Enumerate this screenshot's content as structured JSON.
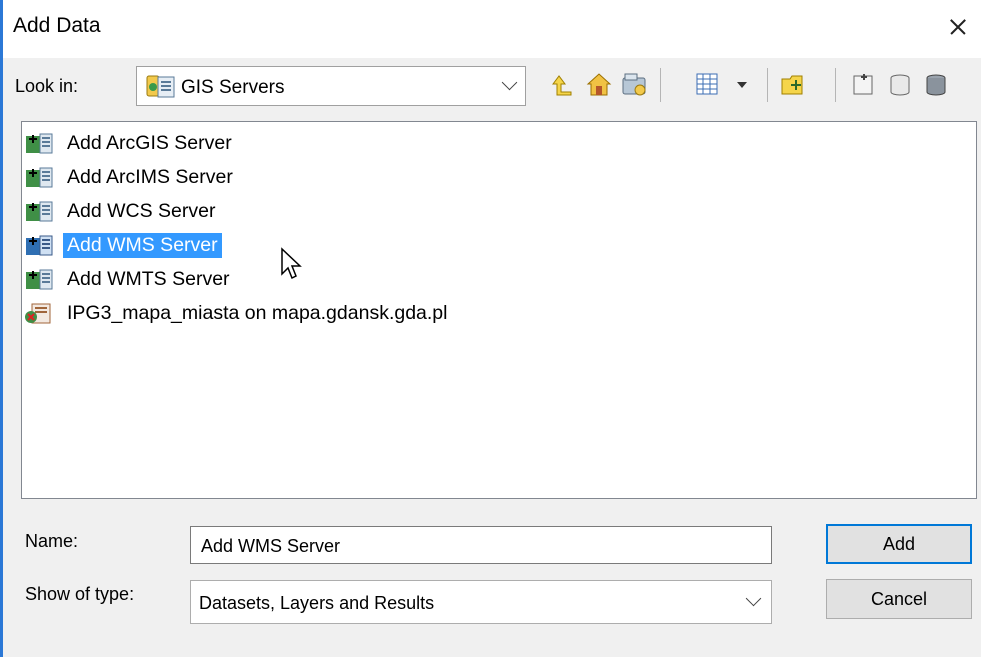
{
  "window": {
    "title": "Add Data"
  },
  "toolbar": {
    "look_in_label": "Look in:",
    "location": "GIS Servers",
    "icons": [
      "up-one-level-icon",
      "home-icon",
      "connect-folder-icon",
      "view-menu-icon",
      "new-folder-icon",
      "new-file-geodatabase-icon",
      "new-personal-geodatabase-icon",
      "new-server-connection-icon"
    ]
  },
  "list": {
    "items": [
      {
        "label": "Add ArcGIS Server",
        "icon": "add-server-icon"
      },
      {
        "label": "Add ArcIMS Server",
        "icon": "add-server-icon"
      },
      {
        "label": "Add WCS Server",
        "icon": "add-server-icon"
      },
      {
        "label": "Add WMS Server",
        "icon": "add-server-icon",
        "selected": true
      },
      {
        "label": "Add WMTS Server",
        "icon": "add-server-icon"
      },
      {
        "label": "IPG3_mapa_miasta on mapa.gdansk.gda.pl",
        "icon": "server-connection-icon"
      }
    ]
  },
  "form": {
    "name_label": "Name:",
    "name_value": "Add WMS Server",
    "type_label": "Show of type:",
    "type_value": "Datasets, Layers and Results"
  },
  "buttons": {
    "add": "Add",
    "cancel": "Cancel"
  },
  "colors": {
    "selection": "#3399ff",
    "accent": "#0078d7",
    "window_border": "#2b78d6"
  }
}
